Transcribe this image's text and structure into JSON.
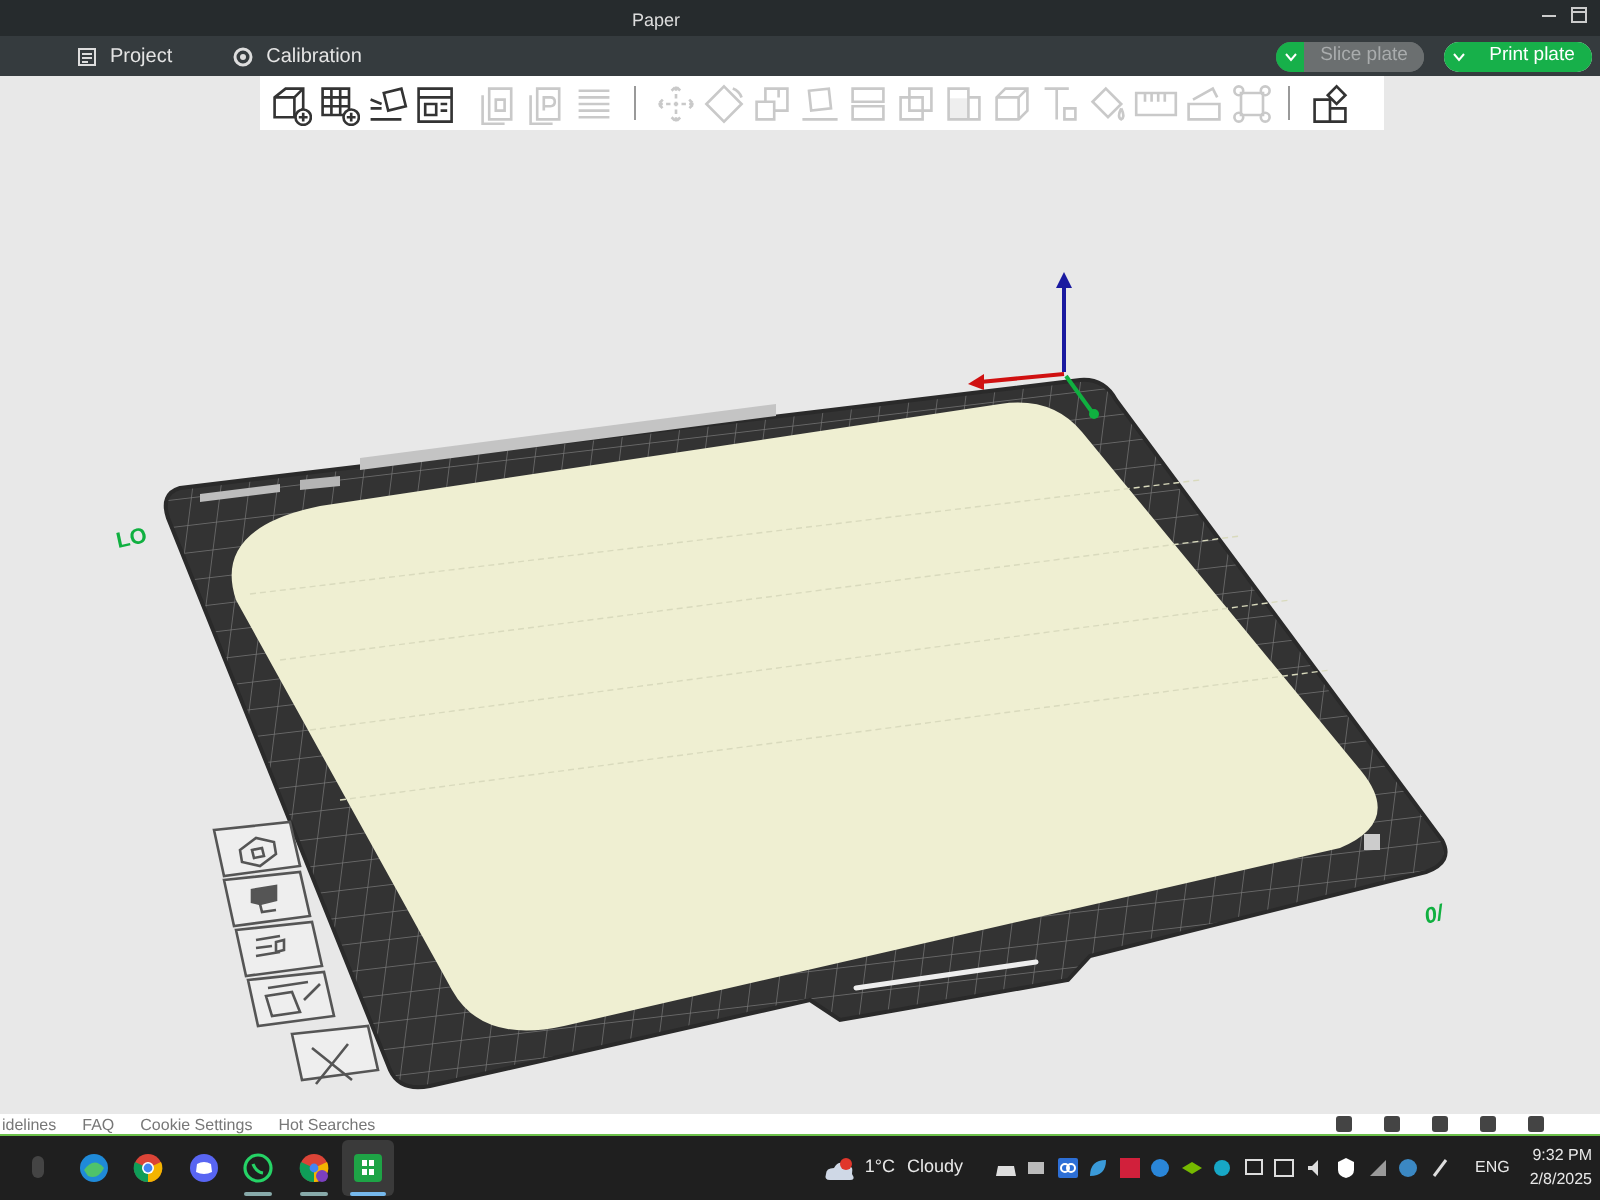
{
  "window": {
    "title": "Paper"
  },
  "tabs": [
    {
      "label": "Project"
    },
    {
      "label": "Calibration"
    }
  ],
  "actions": [
    {
      "label": "Slice plate",
      "disabled": true
    },
    {
      "label": "Print plate",
      "disabled": false
    }
  ],
  "toolbar": [
    {
      "kind": "tool",
      "disabled": false
    },
    {
      "kind": "tool",
      "disabled": false
    },
    {
      "kind": "tool",
      "disabled": false
    },
    {
      "kind": "tool",
      "disabled": false
    },
    {
      "kind": "tool",
      "disabled": true
    },
    {
      "kind": "tool",
      "disabled": true
    },
    {
      "kind": "tool",
      "disabled": true
    },
    {
      "kind": "separator"
    },
    {
      "kind": "tool",
      "disabled": true
    },
    {
      "kind": "tool",
      "disabled": true
    },
    {
      "kind": "tool",
      "disabled": true
    },
    {
      "kind": "tool",
      "disabled": true
    },
    {
      "kind": "tool",
      "disabled": true
    },
    {
      "kind": "tool",
      "disabled": true
    },
    {
      "kind": "tool",
      "disabled": true
    },
    {
      "kind": "tool",
      "disabled": true
    },
    {
      "kind": "tool",
      "disabled": true
    },
    {
      "kind": "tool",
      "disabled": true
    },
    {
      "kind": "tool",
      "disabled": true
    },
    {
      "kind": "tool",
      "disabled": true
    },
    {
      "kind": "tool",
      "disabled": true
    },
    {
      "kind": "separator"
    },
    {
      "kind": "tool",
      "disabled": false
    }
  ],
  "plate": {
    "labels": [
      "LO",
      "0/"
    ]
  },
  "background_page": {
    "links": [
      "idelines",
      "FAQ",
      "Cookie Settings",
      "Hot Searches"
    ]
  },
  "taskbar": {
    "apps": [
      {
        "running": false,
        "selected": false
      },
      {
        "running": false,
        "selected": false
      },
      {
        "running": false,
        "selected": false
      },
      {
        "running": false,
        "selected": false
      },
      {
        "running": true,
        "selected": false
      },
      {
        "running": true,
        "selected": false
      },
      {
        "running": true,
        "selected": true
      }
    ],
    "weather": {
      "temperature": "1°C",
      "condition": "Cloudy"
    },
    "language": "ENG",
    "time": "9:32 PM",
    "date": "2/8/2025"
  }
}
